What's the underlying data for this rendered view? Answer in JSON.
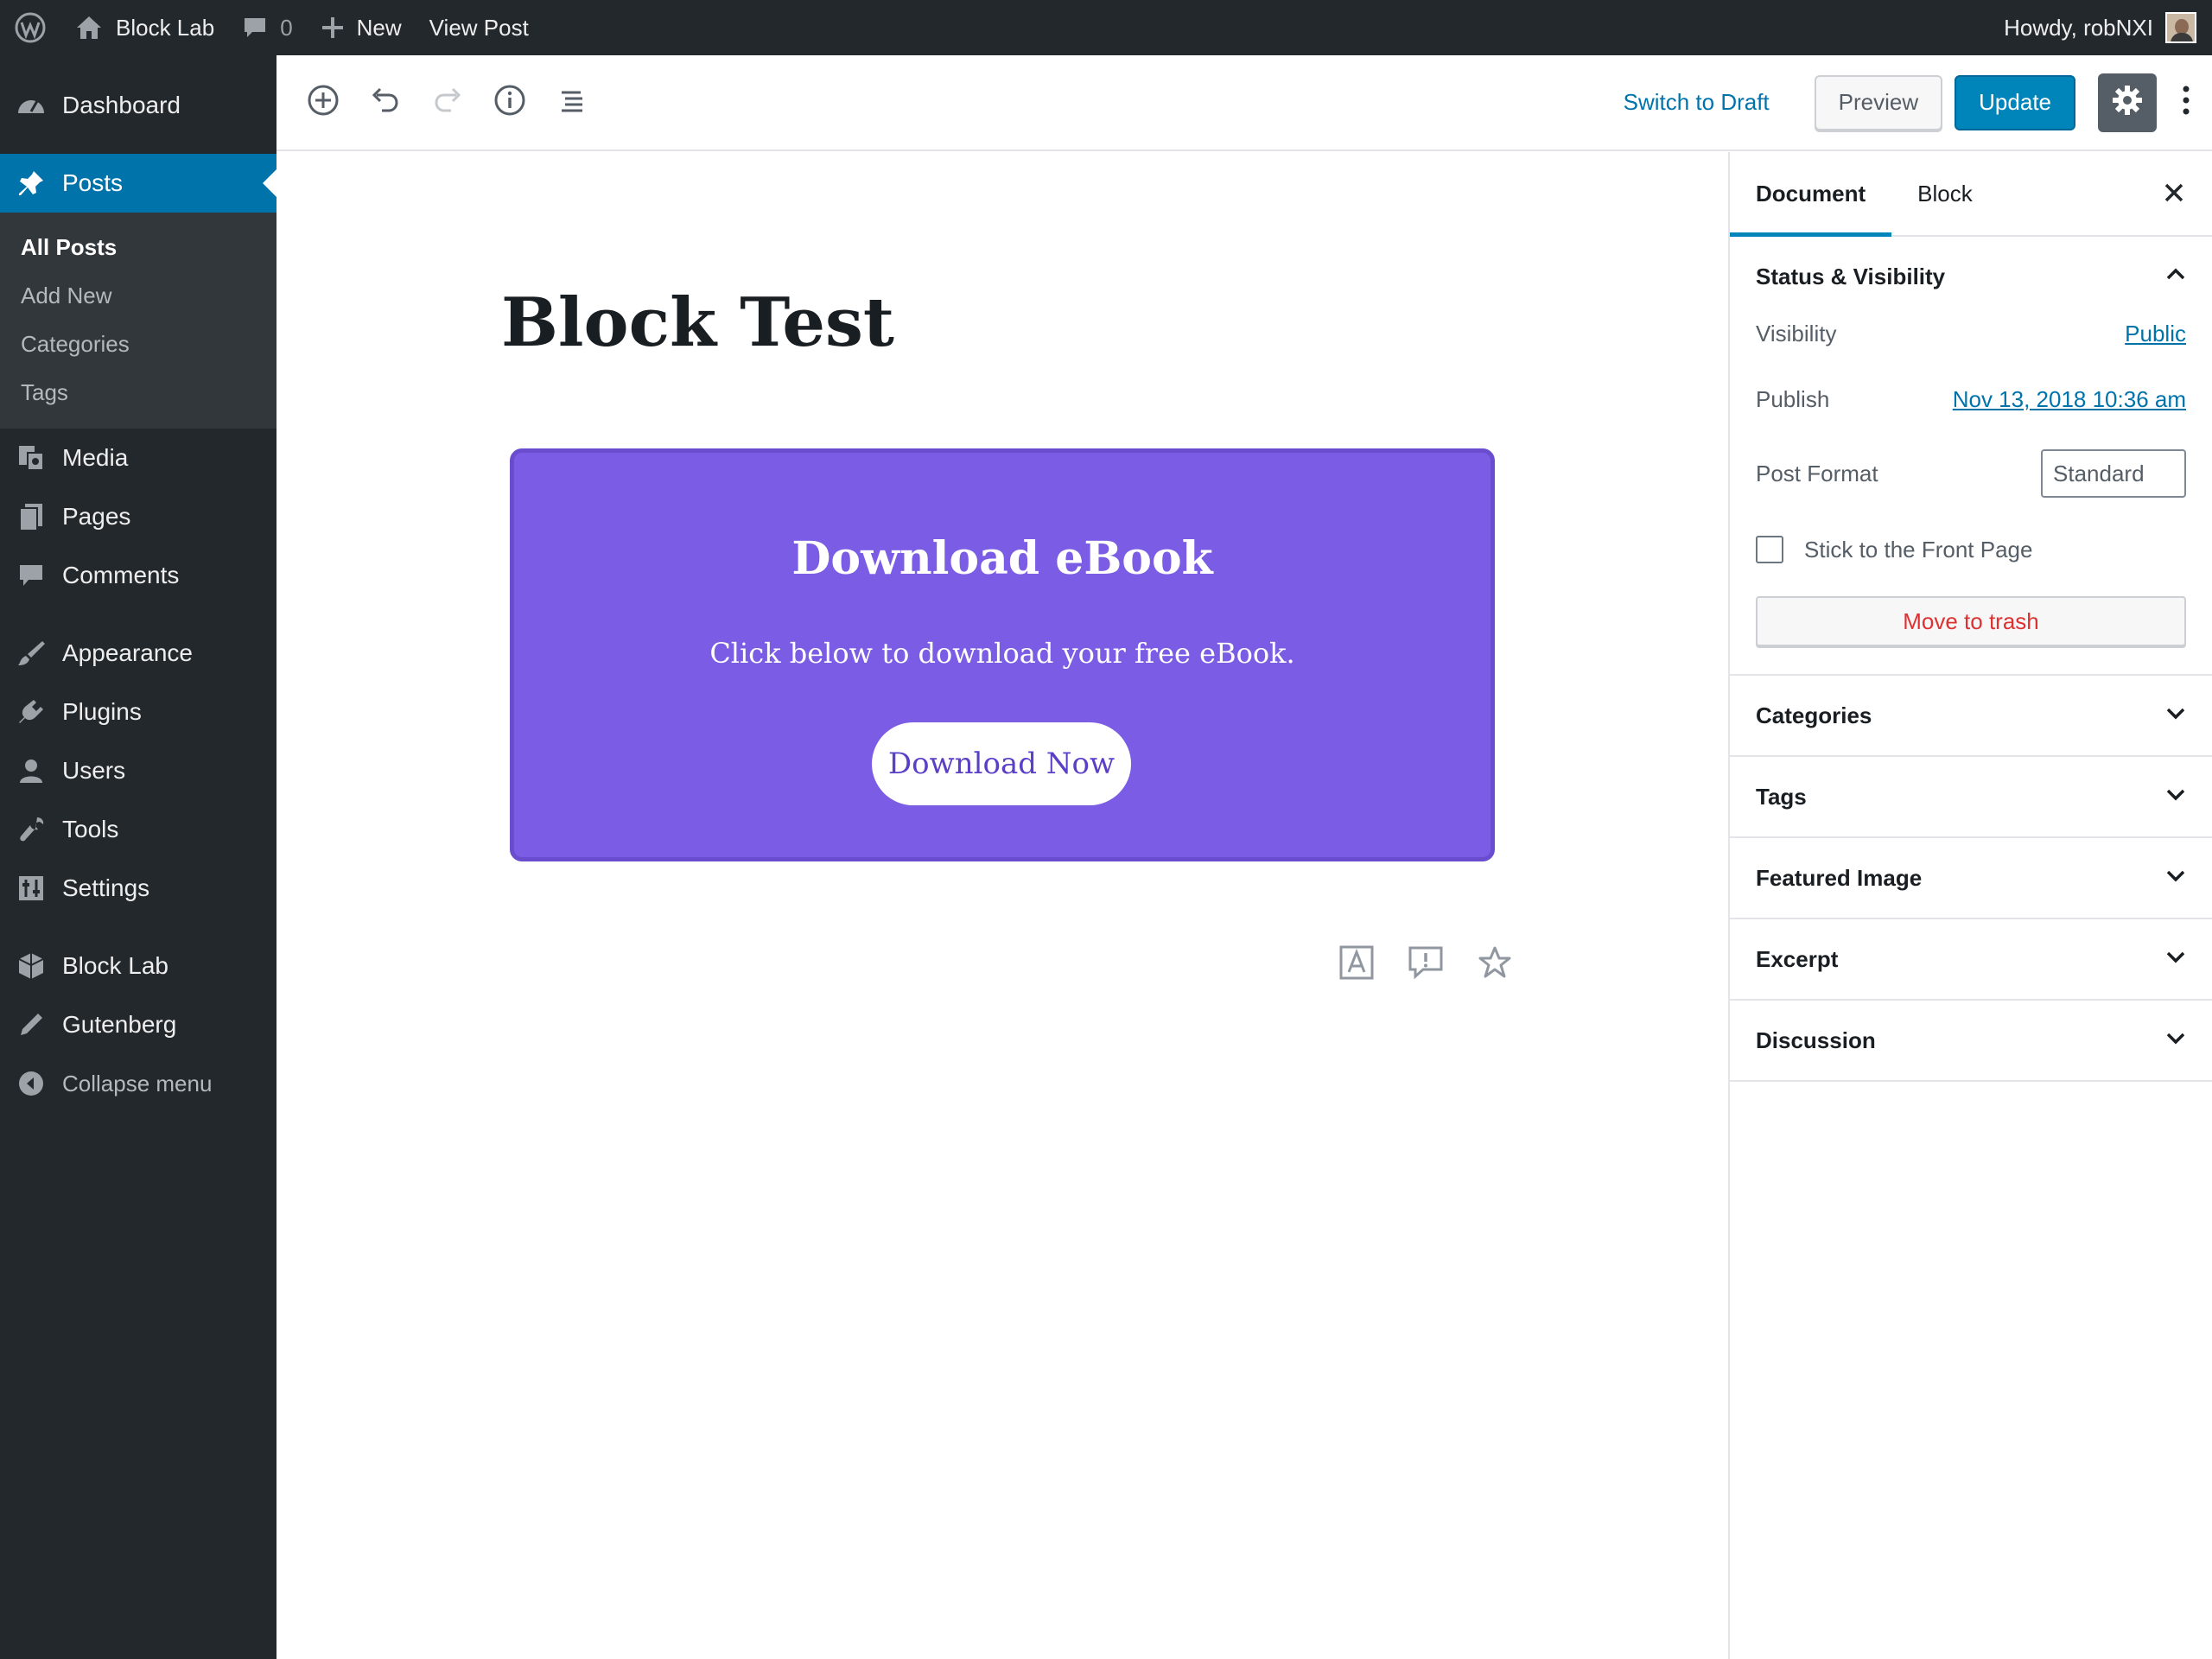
{
  "adminbar": {
    "site_name": "Block Lab",
    "comments_count": "0",
    "new_label": "New",
    "view_post_label": "View Post",
    "howdy": "Howdy, robNXI"
  },
  "sidebar": {
    "dashboard": "Dashboard",
    "posts": "Posts",
    "posts_sub": [
      "All Posts",
      "Add New",
      "Categories",
      "Tags"
    ],
    "media": "Media",
    "pages": "Pages",
    "comments": "Comments",
    "appearance": "Appearance",
    "plugins": "Plugins",
    "users": "Users",
    "tools": "Tools",
    "settings": "Settings",
    "block_lab": "Block Lab",
    "gutenberg": "Gutenberg",
    "collapse": "Collapse menu"
  },
  "toolbar": {
    "switch_to_draft": "Switch to Draft",
    "preview": "Preview",
    "update": "Update"
  },
  "post": {
    "title": "Block Test",
    "cta": {
      "heading": "Download eBook",
      "text": "Click below to download your free eBook.",
      "button": "Download Now",
      "bg_color": "#7b5ce4"
    }
  },
  "settings_sidebar": {
    "tabs": [
      "Document",
      "Block"
    ],
    "status_visibility": {
      "title": "Status & Visibility",
      "visibility_label": "Visibility",
      "visibility_value": "Public",
      "publish_label": "Publish",
      "publish_value": "Nov 13, 2018 10:36 am",
      "post_format_label": "Post Format",
      "post_format_value": "Standard",
      "sticky_label": "Stick to the Front Page",
      "trash_label": "Move to trash"
    },
    "panels": [
      "Categories",
      "Tags",
      "Featured Image",
      "Excerpt",
      "Discussion"
    ]
  },
  "colors": {
    "admin_dark": "#23282d",
    "accent_blue": "#0073aa",
    "primary_button": "#0085ba",
    "danger": "#dc3232"
  }
}
